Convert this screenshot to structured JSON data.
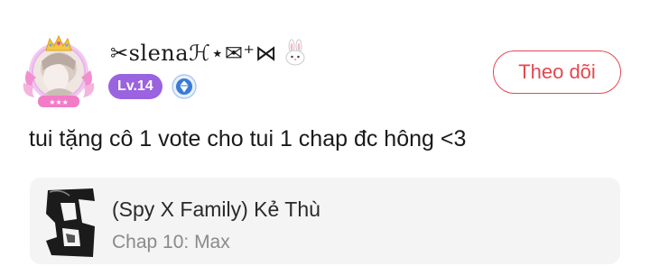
{
  "comment": {
    "user": {
      "name": "✂slenaℋ⋆✉⁺⋈",
      "level": "Lv.14"
    },
    "follow_label": "Theo dõi",
    "text": "tui tặng cô 1 vote cho tui 1 chap đc hông <3",
    "story": {
      "title": "(Spy X Family) Kẻ Thù",
      "chapter": "Chap 10: Max"
    }
  },
  "colors": {
    "accent_red": "#e3484f",
    "level_purple": "#9a63e0",
    "role_blue": "#3a7bd5",
    "card_bg": "#f4f4f4"
  },
  "icons": {
    "avatar_frame": "crown-frame-icon",
    "decoration": "bunny-icon",
    "role": "diamond-badge-icon"
  }
}
